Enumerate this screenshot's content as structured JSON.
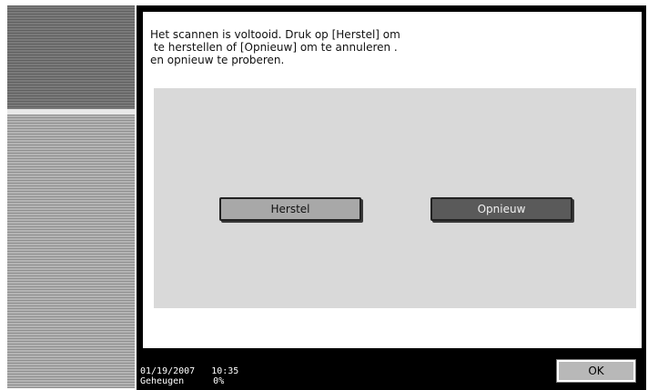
{
  "message": {
    "lines": [
      "Het scannen is voltooid. Druk op [Herstel] om",
      " te herstellen of [Opnieuw] om te annuleren .",
      "en opnieuw te proberen."
    ]
  },
  "buttons": {
    "herstel_label": "Herstel",
    "opnieuw_label": "Opnieuw",
    "ok_label": "OK"
  },
  "status": {
    "date": "01/19/2007",
    "time": "10:35",
    "memory_label": "Geheugen",
    "memory_value": "0%"
  },
  "colors": {
    "frame": "#000000",
    "panel": "#d9d9d9",
    "herstel_button": "#a8a8a8",
    "opnieuw_button": "#5a5a5a"
  }
}
